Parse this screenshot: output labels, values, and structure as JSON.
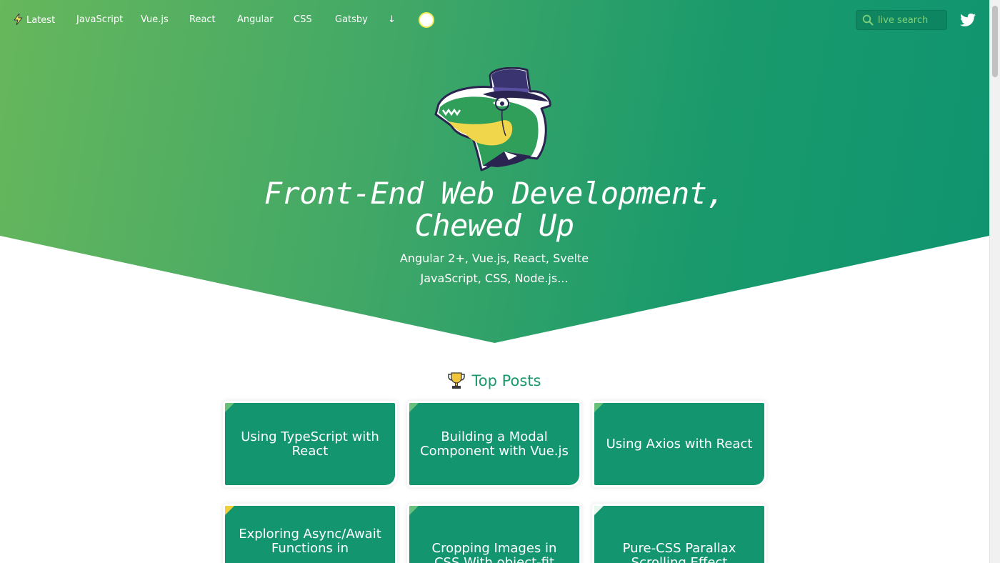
{
  "nav": {
    "items": [
      {
        "label": "Latest",
        "icon": "bolt-icon"
      },
      {
        "label": "JavaScript"
      },
      {
        "label": "Vue.js"
      },
      {
        "label": "React"
      },
      {
        "label": "Angular"
      },
      {
        "label": "CSS"
      },
      {
        "label": "Gatsby"
      },
      {
        "label": "↓"
      }
    ],
    "theme_toggle_icon": "sun-circle-icon"
  },
  "search": {
    "placeholder": "live search",
    "icon": "search-icon"
  },
  "social": {
    "icon": "twitter-icon"
  },
  "hero": {
    "logo_icon": "alligator-top-hat-logo",
    "headline_line1": "Front-End Web Development,",
    "headline_line2": "Chewed Up",
    "tagline_line1": "Angular 2+, Vue.js, React, Svelte",
    "tagline_line2": "JavaScript, CSS, Node.js..."
  },
  "top_posts": {
    "icon": "trophy-icon",
    "title": "Top Posts",
    "cards": [
      {
        "title": "Using TypeScript with React"
      },
      {
        "title": "Building a Modal Component with Vue.js"
      },
      {
        "title": "Using Axios with React"
      },
      {
        "title": "Exploring Async/Await Functions in"
      },
      {
        "title": "Cropping Images in CSS With object-fit"
      },
      {
        "title": "Pure-CSS Parallax Scrolling Effect"
      }
    ]
  },
  "colors": {
    "hero_start": "#67b75c",
    "hero_end": "#0f9470",
    "card": "#13966f",
    "accent": "#1a9a6c"
  }
}
